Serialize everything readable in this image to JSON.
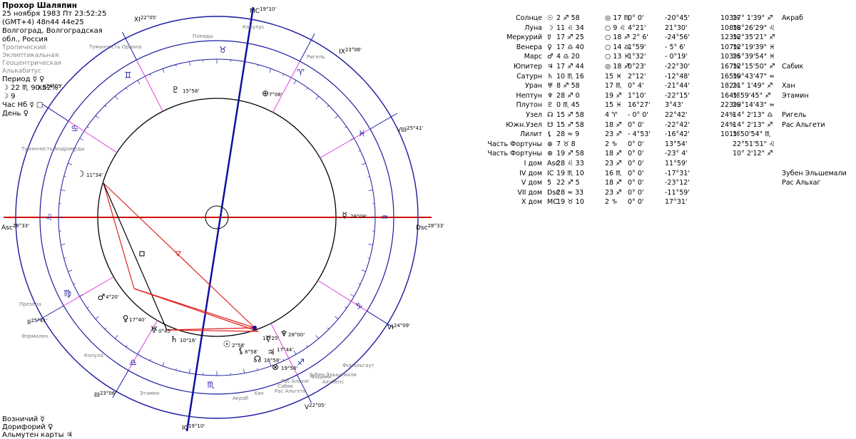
{
  "header": {
    "name": "Прохор Шаляпин",
    "date": "25 ноября 1983  Пт  23:52:25 (GMT+4)  48n44  44e25",
    "place": "Волгоград, Волгоградская обл., Россия",
    "settings": [
      "Тропический",
      "Эклиптикальная",
      "Геоцентрическая",
      "Алькабитус"
    ],
    "period": "Период ☿ ♀",
    "period2": "☽  22 ♏ 90.52%",
    "period3": "☽  9",
    "hour": "Час Нб ☿ □",
    "day": "День ♀"
  },
  "footer": {
    "line1": "Возничий  ☿",
    "line2": "Дорифорий  ♀",
    "line3": "Альмутен карты  ♃"
  },
  "cusps": {
    "mc": "19°10'",
    "ic": "19°10'",
    "asc": "28°33'",
    "dsc": "28°33'",
    "h2": "25°41'",
    "h3": "23°06'",
    "h11": "22°05'",
    "h12": "24°09'",
    "h5": "22°05'",
    "h6": "24°09'",
    "h8": "25°41'",
    "h9": "23°06'",
    "roman": [
      "I",
      "II",
      "III",
      "IV",
      "V",
      "VI",
      "VII",
      "VIII",
      "IX",
      "X",
      "XI",
      "XII"
    ]
  },
  "ring_labels": [
    "Капулус",
    "Плеяды",
    "Туманность Ориона",
    "Ригель",
    "Туманность Андромеды",
    "Презепа",
    "Копула",
    "Фомальгаут",
    "Фацими",
    "Ахубенс",
    "Акраб",
    "Хан",
    "Сабик",
    "Рас Альгети",
    "Рас Альхаг",
    "Этамин",
    "Зубен Эльшемали",
    "Фэрмален"
  ],
  "inner_labels": [
    "11°34'",
    "15°58'",
    "7°08'",
    "28°09'",
    "4°20'",
    "17°40'",
    "0°45'",
    "10°16'",
    "2°58'",
    "8°58'",
    "17°25'",
    "17°44'",
    "28°00'",
    "16°58'",
    "19°58'"
  ],
  "table": {
    "rows": [
      {
        "name": "Солнце",
        "sym": "☉",
        "deg": "2 ♐ 58",
        "hs": "◎ 17 ♏",
        "r1": "0° 0'",
        "r2": "-20°45'",
        "pct": "103%",
        "pos": "27° 1'39\" ♐",
        "star": "Акраб"
      },
      {
        "name": "Луна",
        "sym": "☽",
        "deg": "11 ♌ 34",
        "hs": "○ 9 ♌",
        "r1": "4°21'",
        "r2": "21°30'",
        "pct": "108%",
        "pos": "18°26'29\" ♌",
        "star": ""
      },
      {
        "name": "Меркурий",
        "sym": "☿",
        "deg": "17 ♐ 25",
        "hs": "○ 18 ♐",
        "r1": "- 2° 6'",
        "r2": "-24°56'",
        "pct": "123%",
        "pos": "12°35'21\" ♐",
        "star": ""
      },
      {
        "name": "Венера",
        "sym": "♀",
        "deg": "17 ♎ 40",
        "hs": "○ 14 ♎",
        "r1": "1°59'",
        "r2": "- 5° 6'",
        "pct": "107%",
        "pos": "12°19'39\" ♓",
        "star": ""
      },
      {
        "name": "Марс",
        "sym": "♂",
        "deg": "4 ♎ 20",
        "hs": "○ 13 ♓",
        "r1": "1°32'",
        "r2": "- 0°19'",
        "pct": "103%",
        "pos": "25°39'54\" ♓",
        "star": ""
      },
      {
        "name": "Юпитер",
        "sym": "♃",
        "deg": "17 ♐ 44",
        "hs": "◎ 18 ♐",
        "r1": "0°23'",
        "r2": "-22°30'",
        "pct": "167%",
        "pos": "12°15'50\" ♐",
        "star": "Сабик"
      },
      {
        "name": "Сатурн",
        "sym": "♄",
        "deg": "10 ♏ 16",
        "hs": "15 ♓",
        "r1": "2°12'",
        "r2": "-12°48'",
        "pct": "165%",
        "pos": "19°43'47\" ≈",
        "star": ""
      },
      {
        "name": "Уран",
        "sym": "♅",
        "deg": "8 ♐ 58",
        "hs": "17 ♏",
        "r1": "0° 4'",
        "r2": "-21°44'",
        "pct": "182%",
        "pos": "21° 1'49\" ♐",
        "star": "Хан"
      },
      {
        "name": "Нептун",
        "sym": "♆",
        "deg": "28 ♐ 0",
        "hs": "19 ♐",
        "r1": "1°10'",
        "r2": "-22°15'",
        "pct": "164%",
        "pos": "1°59'45\" ♐",
        "star": "Этамин"
      },
      {
        "name": "Плутон",
        "sym": "♇",
        "deg": "0 ♏ 45",
        "hs": "15 ♓",
        "r1": "16°27'",
        "r2": "3°43'",
        "pct": "223%",
        "pos": "29°14'43\" ≈",
        "star": ""
      },
      {
        "name": "Узел",
        "sym": "☊",
        "deg": "15 ♐ 58",
        "hs": "4 ♈",
        "r1": "- 0° 0'",
        "r2": "22°42'",
        "pct": "24%",
        "pos": "14° 2'13\" ♎",
        "star": "Ригель"
      },
      {
        "name": "Южн.Узел",
        "sym": "☋",
        "deg": "15 ♐ 58",
        "hs": "18 ♐",
        "r1": "0° 0'",
        "r2": "-22°42'",
        "pct": "24%",
        "pos": "14° 2'13\" ♐",
        "star": "Рас Альгети"
      },
      {
        "name": "Лилит",
        "sym": "⚸",
        "deg": "28 ≈ 9",
        "hs": "23 ♐",
        "r1": "- 4°53'",
        "r2": "-16°42'",
        "pct": "101%",
        "pos": "1°50'54\" ♏",
        "star": ""
      },
      {
        "name": "Часть Фортуны",
        "sym": "⊕",
        "deg": "7 ♉ 8",
        "hs": "2 ♑",
        "r1": "0° 0'",
        "r2": "13°54'",
        "pct": "",
        "pos": "22°51'51\" ♌",
        "star": ""
      },
      {
        "name": "Часть Фортуны",
        "sym": "⊗",
        "deg": "19 ♐ 58",
        "hs": "18 ♐",
        "r1": "0° 0'",
        "r2": "-23° 4'",
        "pct": "",
        "pos": "10° 2'12\" ♐",
        "star": ""
      },
      {
        "name": "I дом",
        "sym": "Asc",
        "deg": "28 ♌ 33",
        "hs": "23 ♐",
        "r1": "0° 0'",
        "r2": "11°59'",
        "pct": "",
        "pos": "",
        "star": ""
      },
      {
        "name": "IV дом",
        "sym": "IC",
        "deg": "19 ♏ 10",
        "hs": "16 ♏",
        "r1": "0° 0'",
        "r2": "-17°31'",
        "pct": "",
        "pos": "",
        "star": "Зубен Эльшемали"
      },
      {
        "name": "V дом",
        "sym": "5",
        "deg": "22 ♐ 5",
        "hs": "18 ♐",
        "r1": "0° 0'",
        "r2": "-23°12'",
        "pct": "",
        "pos": "",
        "star": "Рас Альхаг"
      },
      {
        "name": "VII дом",
        "sym": "Dsc",
        "deg": "28 ≈ 33",
        "hs": "23 ♐",
        "r1": "0° 0'",
        "r2": "-11°59'",
        "pct": "",
        "pos": "",
        "star": ""
      },
      {
        "name": "X дом",
        "sym": "MC",
        "deg": "19 ♉ 10",
        "hs": "2 ♑",
        "r1": "0° 0'",
        "r2": "17°31'",
        "pct": "",
        "pos": "",
        "star": ""
      }
    ]
  }
}
